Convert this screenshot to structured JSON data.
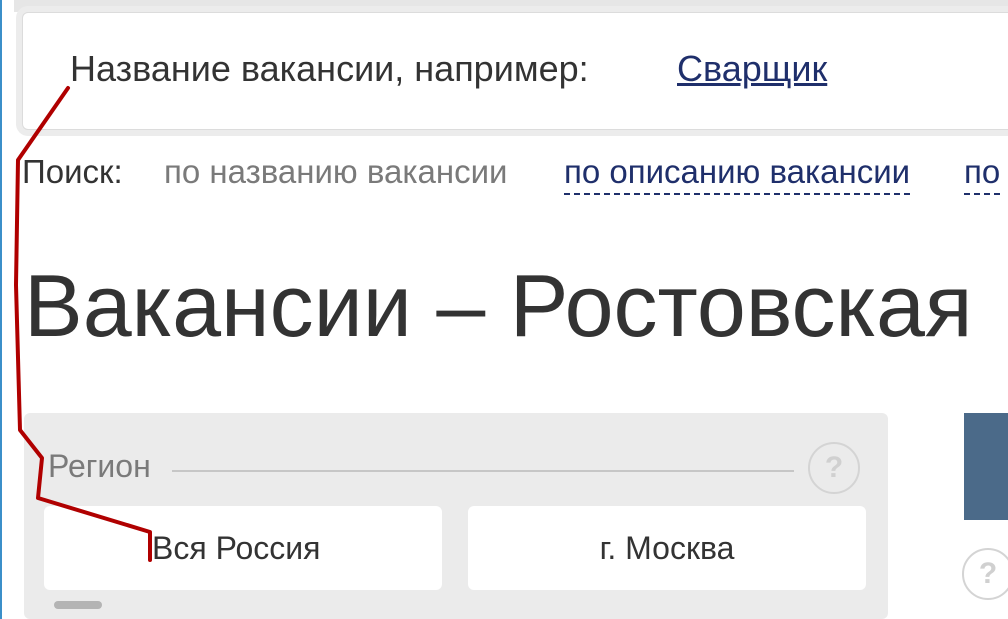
{
  "search": {
    "hint_label": "Название вакансии, например:",
    "example_link": "Сварщик"
  },
  "search_modes": {
    "prefix": "Поиск:",
    "active": "по названию вакансии",
    "options": [
      "по описанию вакансии",
      "по"
    ]
  },
  "page": {
    "title": "Вакансии – Ростовская"
  },
  "region_filter": {
    "label": "Регион",
    "help_icon": "?",
    "options": [
      "Вся Россия",
      "г. Москва"
    ]
  },
  "side_panel": {
    "help_icon": "?"
  },
  "colors": {
    "link": "#1f2f6b",
    "muted_text": "#7a7a7a",
    "panel_bg": "#ebebeb",
    "accent_block": "#4b6a89",
    "annotation_line": "#b00000"
  }
}
